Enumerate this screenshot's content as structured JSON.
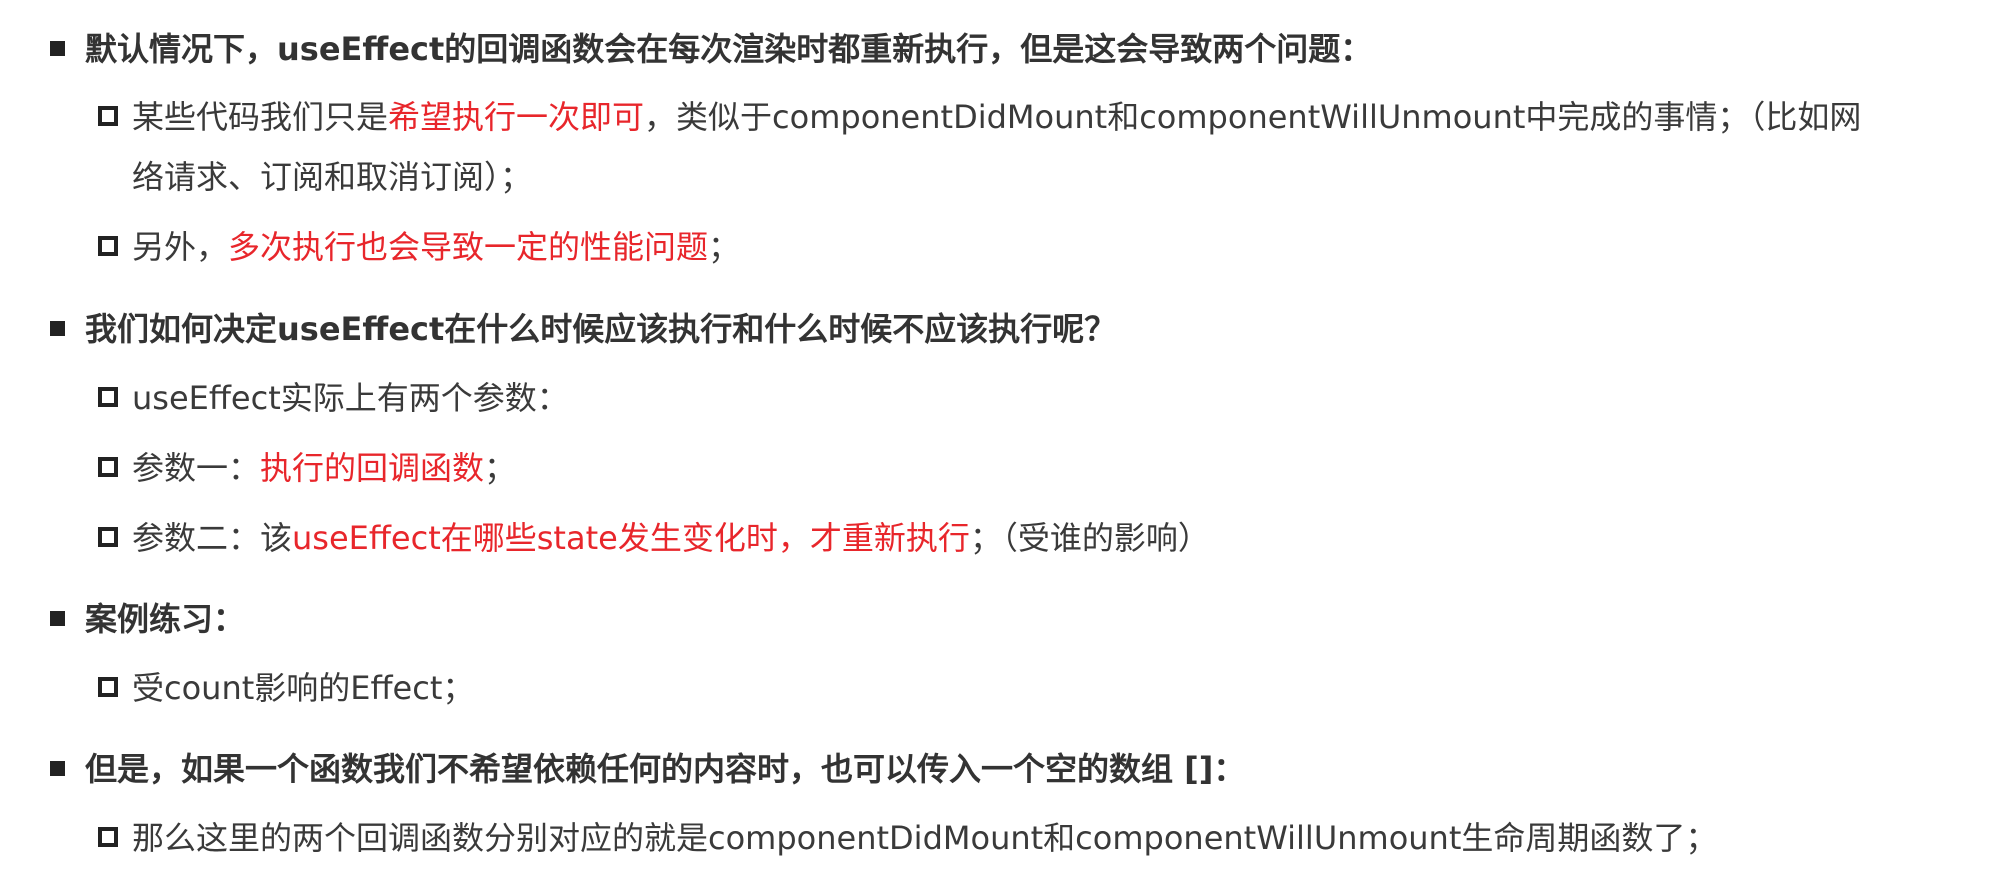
{
  "sections": [
    {
      "heading": "默认情况下，useEffect的回调函数会在每次渲染时都重新执行，但是这会导致两个问题：",
      "items": [
        {
          "pre": "某些代码我们只是",
          "red": "希望执行一次即可",
          "post": "，类似于componentDidMount和componentWillUnmount中完成的事情；（比如网",
          "cont": "络请求、订阅和取消订阅）；"
        },
        {
          "pre": "另外，",
          "red": "多次执行也会导致一定的性能问题",
          "post": "；"
        }
      ]
    },
    {
      "heading": "我们如何决定useEffect在什么时候应该执行和什么时候不应该执行呢？",
      "items": [
        {
          "pre": "useEffect实际上有两个参数：",
          "red": "",
          "post": ""
        },
        {
          "pre": "参数一：",
          "red": "执行的回调函数",
          "post": "；"
        },
        {
          "pre": "参数二：该",
          "red": "useEffect在哪些state发生变化时，才重新执行",
          "post": "；（受谁的影响）"
        }
      ]
    },
    {
      "heading": "案例练习：",
      "items": [
        {
          "pre": "受count影响的Effect；",
          "red": "",
          "post": ""
        }
      ]
    },
    {
      "heading": "但是，如果一个函数我们不希望依赖任何的内容时，也可以传入一个空的数组 []：",
      "items": [
        {
          "pre": "那么这里的两个回调函数分别对应的就是componentDidMount和componentWillUnmount生命周期函数了；",
          "red": "",
          "post": ""
        }
      ]
    }
  ],
  "colors": {
    "text": "#3a3a3a",
    "heading": "#333333",
    "highlight": "#e8262b"
  }
}
